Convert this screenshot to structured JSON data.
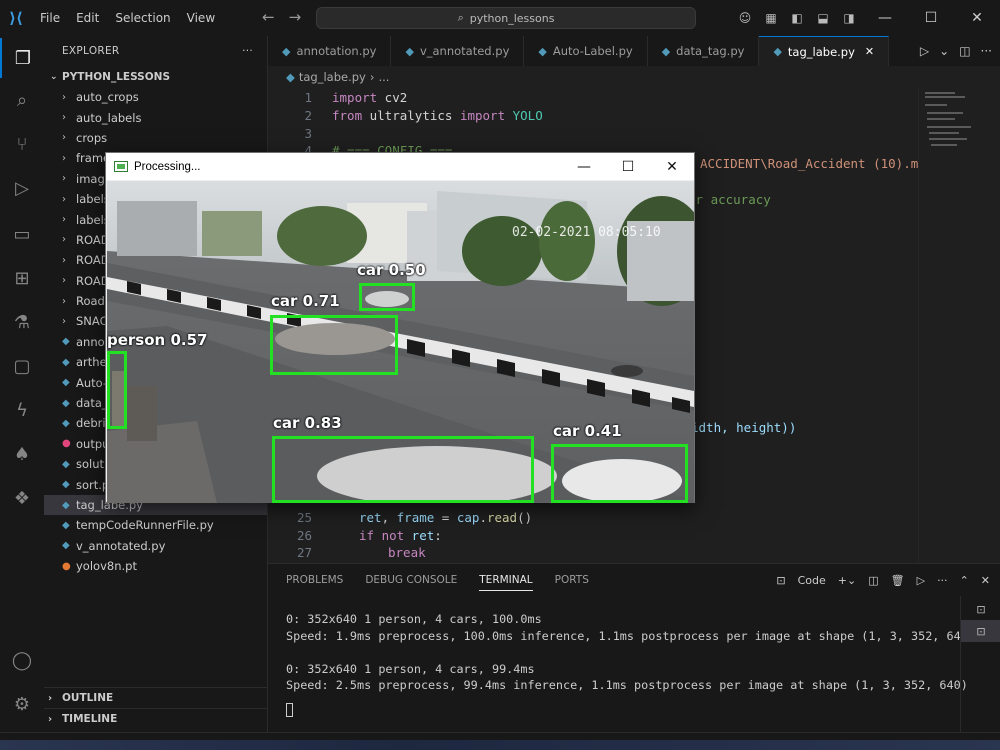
{
  "titlebar": {
    "menu": [
      "File",
      "Edit",
      "Selection",
      "View"
    ],
    "search_text": "python_lessons"
  },
  "explorer": {
    "header": "EXPLORER",
    "root": "PYTHON_LESSONS",
    "items": [
      {
        "label": "auto_crops",
        "type": "folder"
      },
      {
        "label": "auto_labels",
        "type": "folder"
      },
      {
        "label": "crops",
        "type": "folder"
      },
      {
        "label": "frame",
        "type": "folder"
      },
      {
        "label": "imag",
        "type": "folder"
      },
      {
        "label": "labels",
        "type": "folder"
      },
      {
        "label": "labels",
        "type": "folder"
      },
      {
        "label": "ROAD",
        "type": "folder"
      },
      {
        "label": "ROAD",
        "type": "folder"
      },
      {
        "label": "ROAD",
        "type": "folder"
      },
      {
        "label": "Road",
        "type": "folder"
      },
      {
        "label": "SNAC",
        "type": "folder"
      },
      {
        "label": "anno",
        "type": "py"
      },
      {
        "label": "arthe",
        "type": "py"
      },
      {
        "label": "Auto-",
        "type": "py"
      },
      {
        "label": "data_",
        "type": "py"
      },
      {
        "label": "debri",
        "type": "py"
      },
      {
        "label": "outpu",
        "type": "mp4"
      },
      {
        "label": "soluti",
        "type": "py"
      },
      {
        "label": "sort.p",
        "type": "py"
      },
      {
        "label": "tag_labe.py",
        "type": "py"
      },
      {
        "label": "tempCodeRunnerFile.py",
        "type": "py"
      },
      {
        "label": "v_annotated.py",
        "type": "py"
      },
      {
        "label": "yolov8n.pt",
        "type": "pt"
      }
    ],
    "outline": "OUTLINE",
    "timeline": "TIMELINE"
  },
  "tabs": [
    {
      "label": "annotation.py",
      "active": false
    },
    {
      "label": "v_annotated.py",
      "active": false
    },
    {
      "label": "Auto-Label.py",
      "active": false
    },
    {
      "label": "data_tag.py",
      "active": false
    },
    {
      "label": "tag_labe.py",
      "active": true
    }
  ],
  "breadcrumb": {
    "file": "tag_labe.py",
    "rest": "..."
  },
  "editor": {
    "line1": {
      "num": "1",
      "kw": "import",
      "mod": " cv2"
    },
    "line2": {
      "num": "2",
      "kw1": "from",
      "mod": " ultralytics ",
      "kw2": "import",
      "cls": " YOLO"
    },
    "line3": {
      "num": "3"
    },
    "line4": {
      "num": "4",
      "comment": "# === CONFIG ==="
    },
    "frag_path": "ACCIDENT\\Road_Accident (10).mp4",
    "frag_accuracy": "er accuracy",
    "frag_width": "idth, height))",
    "line25": {
      "num": "25",
      "a": "ret",
      "b": ", ",
      "c": "frame",
      "d": " = ",
      "e": "cap",
      "f": ".",
      "g": "read",
      "h": "()"
    },
    "line26": {
      "num": "26",
      "kw": "if not",
      "var": " ret",
      "rest": ":"
    },
    "line27": {
      "num": "27",
      "kw": "break"
    }
  },
  "panel": {
    "tabs": [
      "PROBLEMS",
      "DEBUG CONSOLE",
      "TERMINAL",
      "PORTS"
    ],
    "active_tab": "TERMINAL",
    "shell_label": "Code",
    "terminal": [
      "0: 352x640 1 person, 4 cars, 100.0ms",
      "Speed: 1.9ms preprocess, 100.0ms inference, 1.1ms postprocess per image at shape (1, 3, 352, 640)",
      "",
      "0: 352x640 1 person, 4 cars, 99.4ms",
      "Speed: 2.5ms preprocess, 99.4ms inference, 1.1ms postprocess per image at shape (1, 3, 352, 640)"
    ]
  },
  "processing_window": {
    "title": "Processing...",
    "timestamp": "02-02-2021 08:05:10",
    "detections": [
      {
        "label": "car 0.50"
      },
      {
        "label": "car 0.71"
      },
      {
        "label": "person 0.57"
      },
      {
        "label": "car 0.83"
      },
      {
        "label": "car 0.41"
      }
    ]
  }
}
